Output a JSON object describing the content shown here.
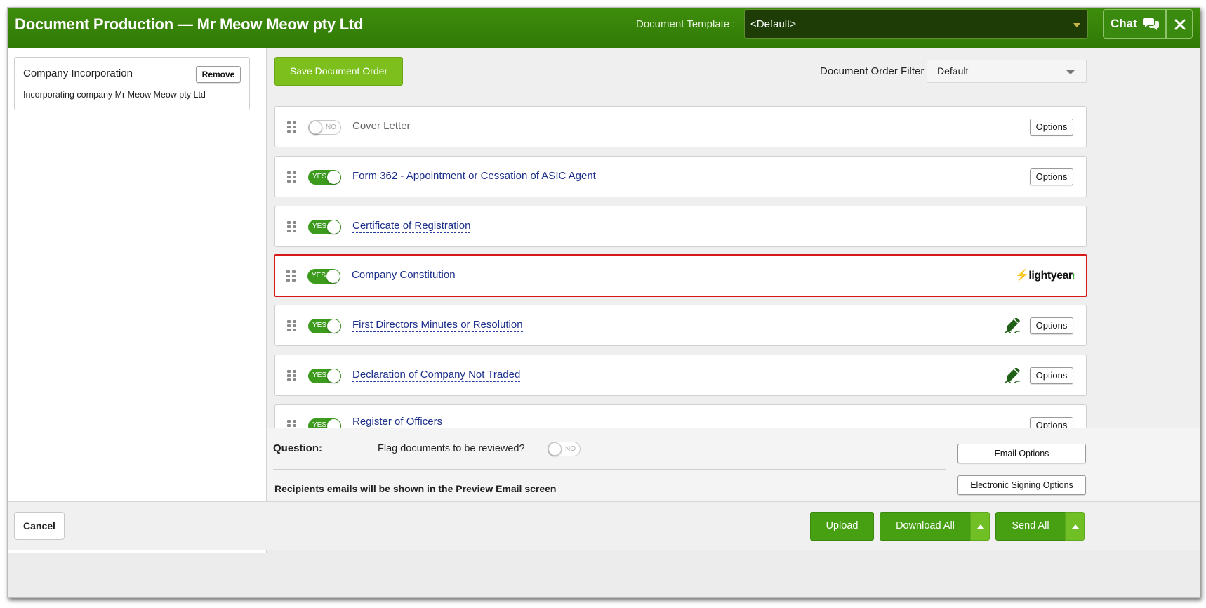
{
  "header": {
    "title": "Document Production — Mr Meow Meow pty Ltd",
    "template_label": "Document Template :",
    "template_value": "<Default>",
    "chat_label": "Chat"
  },
  "left": {
    "card_title": "Company Incorporation",
    "card_subtitle": "Incorporating company Mr Meow Meow pty Ltd",
    "remove_label": "Remove"
  },
  "toolbar": {
    "save_order_label": "Save Document Order",
    "filter_label": "Document Order Filter",
    "filter_value": "Default"
  },
  "documents": [
    {
      "name": "Cover Letter",
      "enabled": false,
      "toggle": "NO",
      "options": "Options"
    },
    {
      "name": "Form 362 - Appointment or Cessation of ASIC Agent",
      "enabled": true,
      "toggle": "YES",
      "options": "Options"
    },
    {
      "name": "Certificate of Registration",
      "enabled": true,
      "toggle": "YES"
    },
    {
      "name": "Company Constitution",
      "enabled": true,
      "toggle": "YES",
      "brand": "lightyear",
      "highlighted": true
    },
    {
      "name": "First Directors Minutes or Resolution",
      "enabled": true,
      "toggle": "YES",
      "options": "Options",
      "sign_icon": true
    },
    {
      "name": "Declaration of Company Not Traded",
      "enabled": true,
      "toggle": "YES",
      "options": "Options",
      "sign_icon": true
    },
    {
      "name": "Register of Officers",
      "enabled": true,
      "toggle": "YES",
      "options": "Options"
    }
  ],
  "question": {
    "label": "Question:",
    "text": "Flag documents to be reviewed?",
    "toggle": "NO",
    "recipients_note": "Recipients emails will be shown in the Preview Email screen",
    "email_options": "Email Options",
    "esign_options": "Electronic Signing Options"
  },
  "footer": {
    "cancel": "Cancel",
    "upload": "Upload",
    "download_all": "Download All",
    "send_all": "Send All"
  },
  "colors": {
    "header_green": "#2f7a05",
    "button_green": "#47a012",
    "save_green": "#7dc01d",
    "link_blue": "#1c2f8a",
    "highlight_red": "#d61818"
  }
}
